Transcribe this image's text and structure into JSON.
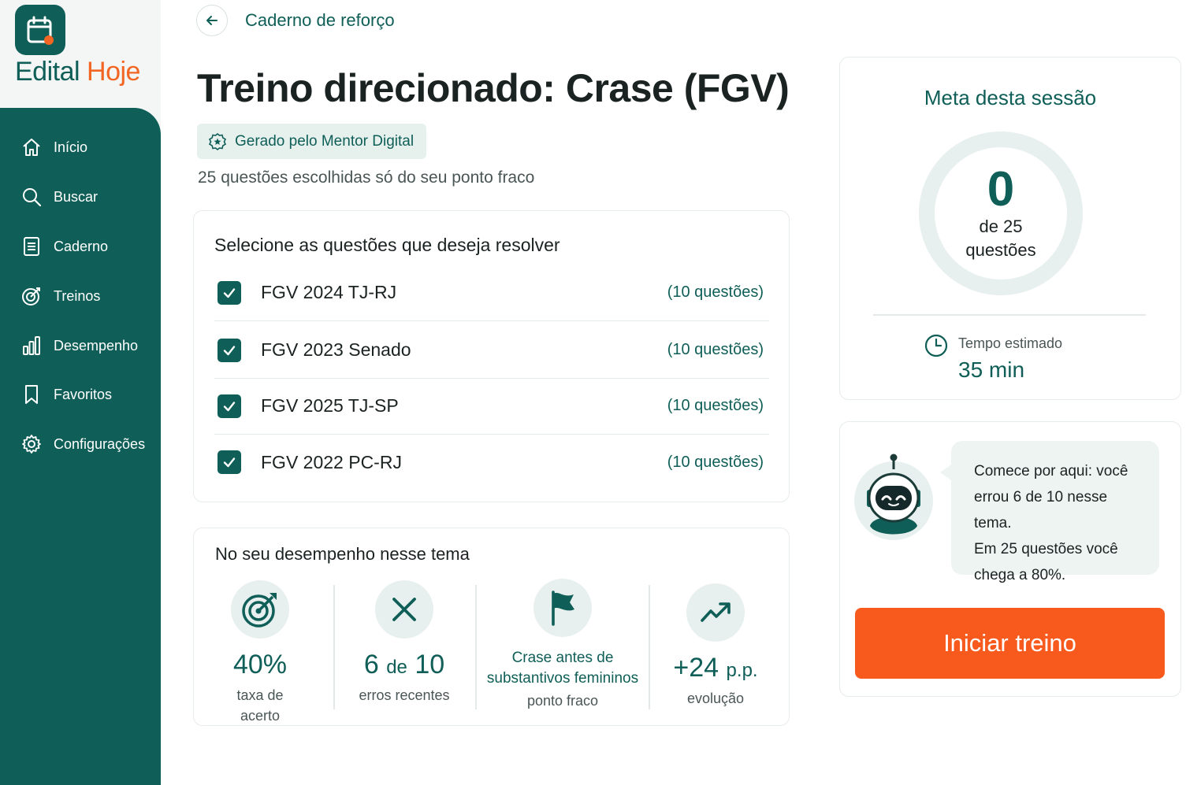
{
  "brand": {
    "name_part1": "Edital",
    "name_part2": "Hoje"
  },
  "sidebar": {
    "items": [
      {
        "label": "Início"
      },
      {
        "label": "Buscar"
      },
      {
        "label": "Caderno"
      },
      {
        "label": "Treinos"
      },
      {
        "label": "Desempenho"
      },
      {
        "label": "Favoritos"
      },
      {
        "label": "Configurações"
      }
    ]
  },
  "header": {
    "breadcrumb": "Caderno de reforço",
    "title": "Treino direcionado: Crase (FGV)",
    "badge": "Gerado pelo Mentor Digital",
    "subtitle": "25 questões escolhidas só do seu ponto fraco"
  },
  "selection": {
    "heading": "Selecione as questões que deseja resolver",
    "items": [
      {
        "name": "FGV 2024 TJ-RJ",
        "count": "(10 questões)",
        "checked": true
      },
      {
        "name": "FGV 2023 Senado",
        "count": "(10 questões)",
        "checked": true
      },
      {
        "name": "FGV 2025 TJ-SP",
        "count": "(10 questões)",
        "checked": true
      },
      {
        "name": "FGV 2022 PC-RJ",
        "count": "(10 questões)",
        "checked": true
      }
    ]
  },
  "performance": {
    "heading": "No seu desempenho nesse tema",
    "stats": [
      {
        "icon": "target-icon",
        "value": "40%",
        "label": "taxa de acerto"
      },
      {
        "icon": "x-icon",
        "value_main": "6",
        "value_sep": "de",
        "value_total": "10",
        "label": "erros recentes"
      },
      {
        "icon": "flag-icon",
        "line1": "Crase antes de",
        "line2": "substantivos femininos",
        "label": "ponto fraco"
      },
      {
        "icon": "trend-up-icon",
        "value": "+24",
        "unit": "p.p.",
        "label": "evolução"
      }
    ]
  },
  "goal": {
    "heading": "Meta desta sessão",
    "completed": "0",
    "total_text": "de 25",
    "unit_text": "questões",
    "progress": 0,
    "time_label": "Tempo estimado",
    "time_value": "35 min"
  },
  "mentor": {
    "line1": "Comece por aqui: você",
    "line2": "errou 6 de 10 nesse tema.",
    "line3": "Em 25 questões você",
    "line4": "chega a 80%.",
    "start_button": "Iniciar treino"
  },
  "colors": {
    "primary": "#0f5e57",
    "accent": "#f75a1c",
    "brand_orange": "#f26522",
    "light_bg": "#e7f0ee"
  }
}
